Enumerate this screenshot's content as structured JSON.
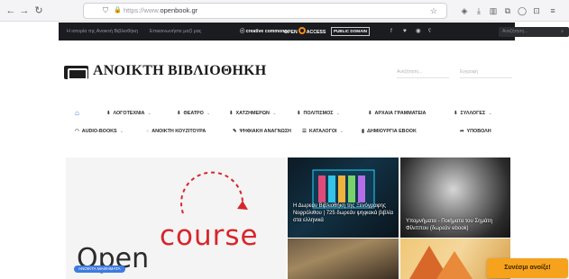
{
  "browser": {
    "url_dim": "https://www.",
    "url_domain": "openbook.gr",
    "icons": [
      "back-icon",
      "forward-icon",
      "reload-icon",
      "shield-icon",
      "lock-icon",
      "star-icon",
      "pocket-icon",
      "download-icon",
      "library-icon",
      "extensions-icon",
      "account-icon",
      "menu-icon"
    ]
  },
  "topbar": {
    "link1": "Η ιστορία της Ανοικτή Βιβλιοθήκη",
    "link2": "Επικοινωνήστε μαζί μας",
    "cc_label": "creative commons",
    "oa_open": "OPEN",
    "oa_access": "ACCESS",
    "pd_label": "PUBLIC DOMAIN",
    "social": [
      "f",
      "♥",
      "◉",
      "ʕ"
    ],
    "search_placeholder": "Αναζήτηση..."
  },
  "header": {
    "logo_text": "ΑΝΟΙΚΤΗ ΒΙΒΛΙΟΘΗΚΗ",
    "field1": "Αναζήτηση...",
    "field2": "Εγγραφή"
  },
  "menu_row1": [
    {
      "label": "ΛΟΓΟΤΕΧΝΙΑ"
    },
    {
      "label": "ΘΕΑΤΡΟ"
    },
    {
      "label": "ΧΑΤΖΗΜΕΡΩΝ"
    },
    {
      "label": "ΠΟΛΙΤΙΣΜΟΣ"
    },
    {
      "label": "ΑΡΧΑΙΑ ΓΡΑΜΜΑΤΕΙΑ"
    },
    {
      "label": "ΣΥΛΛΟΓΕΣ"
    }
  ],
  "menu_row2": [
    {
      "label": "AUDIO-BOOKS"
    },
    {
      "label": "ΑΝΟΙΚΤΗ ΚΟΥΖΙΤΟΥΡΑ"
    },
    {
      "label": "ΨΗΦΙΑΚΗ ΑΝΑΓΝΩΣΗ"
    },
    {
      "label": "ΚΑΤΑΛΟΓΟΙ"
    },
    {
      "label": "ΔΗΜΙΟΥΡΓΙΑ EBOOK"
    },
    {
      "label": "ΥΠΟΒΟΛΗ"
    }
  ],
  "hero": {
    "line1": "Open",
    "line2": "course",
    "tag": "ΑΝΟΙΚΤΑ ΜΑΘΗΜΑΤΑ"
  },
  "tiles": [
    {
      "caption": "Η Δωρεάν Βιβλιοθήκη της Ξενόγραφης Νεφρόλιθου | 725 δωρεάν ψηφιακά βιβλία στα ελληνικά"
    },
    {
      "caption": "Υπομνήματα - Ποιήματα του Σημάτη Φίλιππου (δωρεάν ebook)"
    }
  ],
  "support_label": "Συνέσμι ανοίξε!"
}
